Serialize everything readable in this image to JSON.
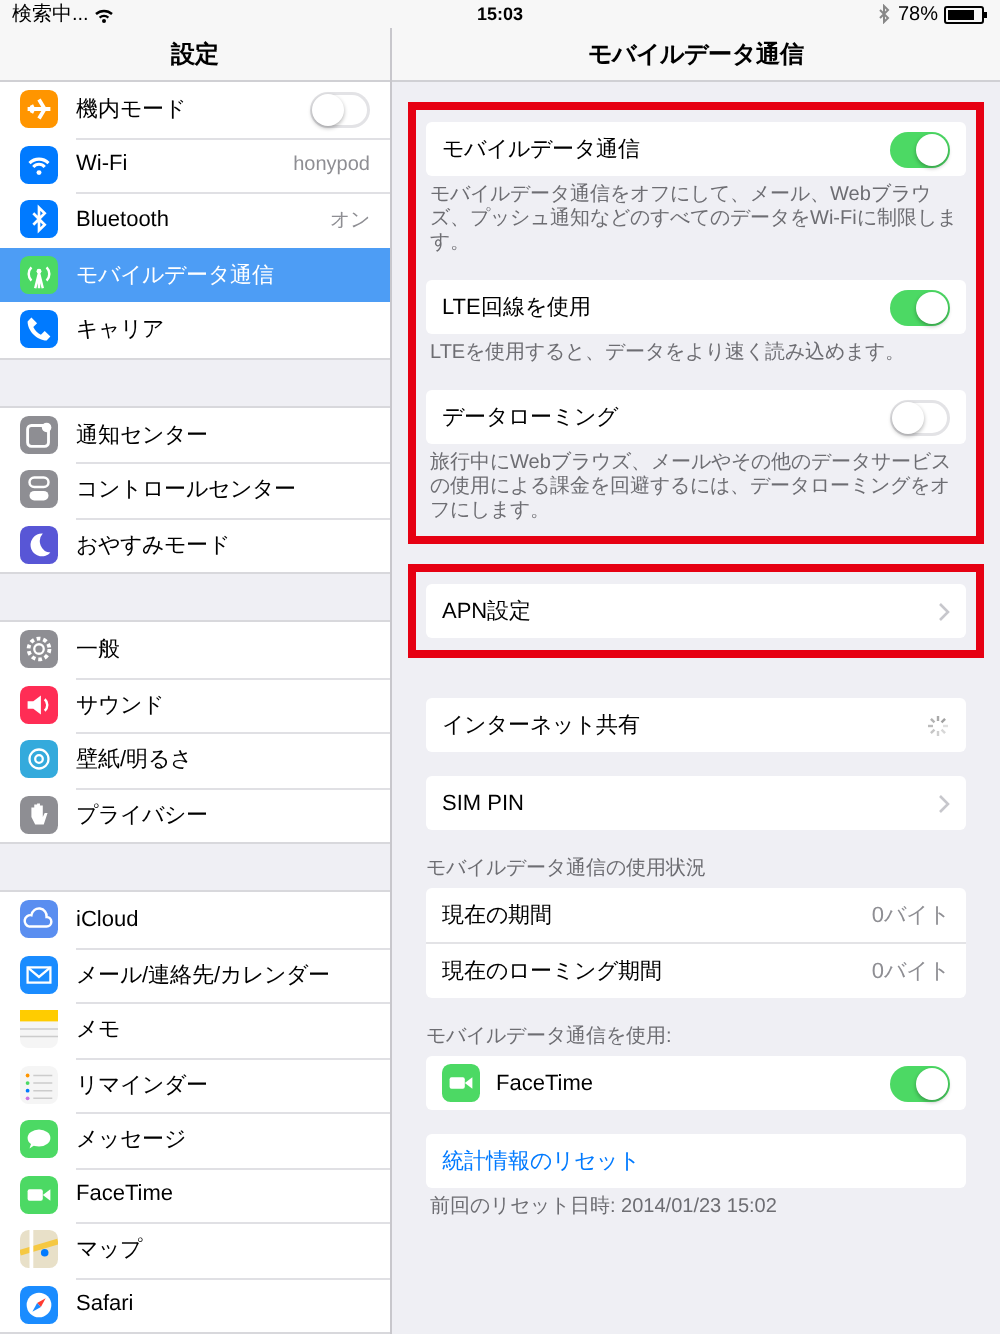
{
  "status_bar": {
    "carrier": "検索中...",
    "time": "15:03",
    "battery": "78%"
  },
  "sidebar": {
    "title": "設定",
    "groups": [
      {
        "items": [
          {
            "kind": "toggle",
            "label": "機内モード",
            "on": false,
            "selected": false
          },
          {
            "kind": "nav",
            "label": "Wi-Fi",
            "value": "honypod",
            "selected": false
          },
          {
            "kind": "nav",
            "label": "Bluetooth",
            "value": "オン",
            "selected": false
          },
          {
            "kind": "nav",
            "label": "モバイルデータ通信",
            "selected": true
          },
          {
            "kind": "nav",
            "label": "キャリア",
            "selected": false
          }
        ]
      },
      {
        "items": [
          {
            "kind": "nav",
            "label": "通知センター",
            "selected": false
          },
          {
            "kind": "nav",
            "label": "コントロールセンター",
            "selected": false
          },
          {
            "kind": "nav",
            "label": "おやすみモード",
            "selected": false
          }
        ]
      },
      {
        "items": [
          {
            "kind": "nav",
            "label": "一般",
            "selected": false
          },
          {
            "kind": "nav",
            "label": "サウンド",
            "selected": false
          },
          {
            "kind": "nav",
            "label": "壁紙/明るさ",
            "selected": false
          },
          {
            "kind": "nav",
            "label": "プライバシー",
            "selected": false
          }
        ]
      },
      {
        "items": [
          {
            "kind": "nav",
            "label": "iCloud",
            "selected": false
          },
          {
            "kind": "nav",
            "label": "メール/連絡先/カレンダー",
            "selected": false
          },
          {
            "kind": "nav",
            "label": "メモ",
            "selected": false
          },
          {
            "kind": "nav",
            "label": "リマインダー",
            "selected": false
          },
          {
            "kind": "nav",
            "label": "メッセージ",
            "selected": false
          },
          {
            "kind": "nav",
            "label": "FaceTime",
            "selected": false
          },
          {
            "kind": "nav",
            "label": "マップ",
            "selected": false
          },
          {
            "kind": "nav",
            "label": "Safari",
            "selected": false
          }
        ]
      }
    ]
  },
  "detail": {
    "title": "モバイルデータ通信",
    "blocks": [
      {
        "highlighted": true,
        "sections": [
          {
            "rows": [
              {
                "kind": "toggle",
                "label": "モバイルデータ通信",
                "on": true
              }
            ],
            "footer": "モバイルデータ通信をオフにして、メール、Webブラウズ、プッシュ通知などのすべてのデータをWi-Fiに制限します。"
          },
          {
            "rows": [
              {
                "kind": "toggle",
                "label": "LTE回線を使用",
                "on": true
              }
            ],
            "footer": "LTEを使用すると、データをより速く読み込めます。"
          },
          {
            "rows": [
              {
                "kind": "toggle",
                "label": "データローミング",
                "on": false
              }
            ],
            "footer": "旅行中にWebブラウズ、メールやその他のデータサービスの使用による課金を回避するには、データローミングをオフにします。"
          }
        ]
      },
      {
        "highlighted": true,
        "sections": [
          {
            "rows": [
              {
                "kind": "nav",
                "label": "APN設定"
              }
            ]
          }
        ]
      },
      {
        "highlighted": false,
        "sections": [
          {
            "rows": [
              {
                "kind": "spinner",
                "label": "インターネット共有"
              }
            ]
          },
          {
            "rows": [
              {
                "kind": "nav",
                "label": "SIM PIN"
              }
            ]
          },
          {
            "header": "モバイルデータ通信の使用状況",
            "rows": [
              {
                "kind": "value",
                "label": "現在の期間",
                "value": "0バイト"
              },
              {
                "kind": "value",
                "label": "現在のローミング期間",
                "value": "0バイト"
              }
            ]
          },
          {
            "header": "モバイルデータ通信を使用:",
            "rows": [
              {
                "kind": "app-toggle",
                "label": "FaceTime",
                "on": true
              }
            ]
          },
          {
            "rows": [
              {
                "kind": "link",
                "label": "統計情報のリセット"
              }
            ],
            "footer": "前回のリセット日時: 2014/01/23 15:02"
          }
        ]
      }
    ]
  }
}
